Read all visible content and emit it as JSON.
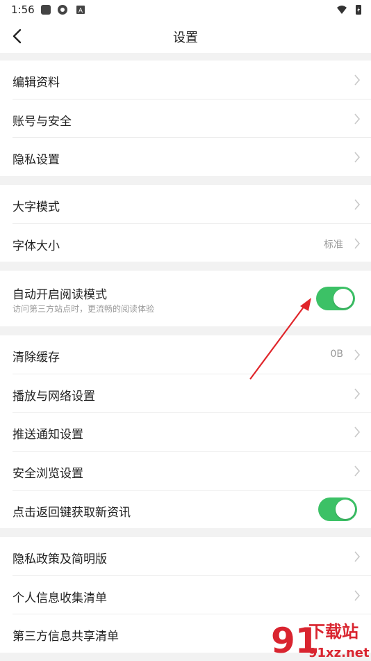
{
  "status_bar": {
    "time": "1:56"
  },
  "header": {
    "title": "设置"
  },
  "sections": {
    "account": {
      "items": [
        "编辑资料",
        "账号与安全",
        "隐私设置"
      ]
    },
    "display": {
      "large_font": "大字模式",
      "font_size": "字体大小",
      "font_size_value": "标准"
    },
    "reading": {
      "label": "自动开启阅读模式",
      "desc": "访问第三方站点时，更流畅的阅读体验",
      "enabled": true
    },
    "general": {
      "clear_cache": "清除缓存",
      "cache_value": "0B",
      "playback": "播放与网络设置",
      "push": "推送通知设置",
      "safe_browse": "安全浏览设置",
      "back_news": "点击返回键获取新资讯",
      "back_news_enabled": true
    },
    "privacy": {
      "items": [
        "隐私政策及简明版",
        "个人信息收集清单",
        "第三方信息共享清单"
      ]
    }
  },
  "watermark": {
    "brand": "下载站",
    "site": "91xz.net"
  },
  "colors": {
    "toggle_on": "#3cc166",
    "arrow": "#e0262b"
  }
}
